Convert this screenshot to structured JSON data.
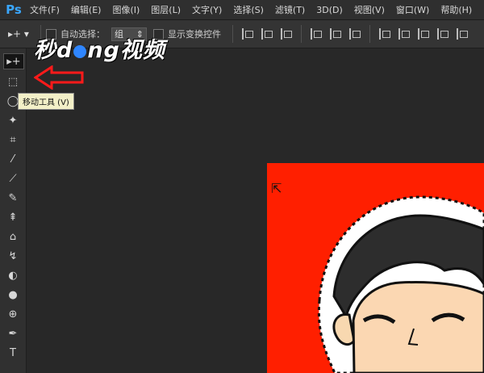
{
  "app": {
    "logo": "Ps"
  },
  "menu": [
    "文件(F)",
    "编辑(E)",
    "图像(I)",
    "图层(L)",
    "文字(Y)",
    "选择(S)",
    "滤镜(T)",
    "3D(D)",
    "视图(V)",
    "窗口(W)",
    "帮助(H)"
  ],
  "options": {
    "tool_icon": "move-icon",
    "auto_select_label": "自动选择：",
    "auto_select_value": "组",
    "show_transform_label": "显示变换控件"
  },
  "watermark": {
    "prefix": "秒",
    "middle": "d",
    "suffix": "ng视频"
  },
  "tools": [
    "▸+",
    "⬚",
    "◯",
    "✦",
    "⌗",
    "⁄",
    "⟋",
    "✎",
    "⇞",
    "⌂",
    "↯",
    "◐",
    "●",
    "⊕",
    "✒",
    "T"
  ],
  "tooltip": "移动工具 (V)",
  "colors": {
    "canvas_red": "#ff1f00",
    "arrow_red": "#ff1a1a"
  }
}
